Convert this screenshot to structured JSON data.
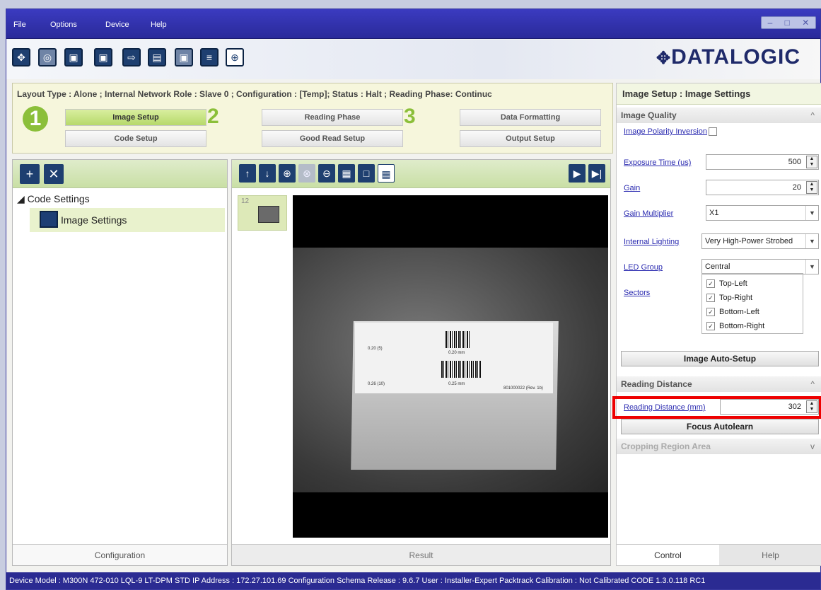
{
  "menu": {
    "file": "File",
    "options": "Options",
    "device": "Device",
    "help": "Help"
  },
  "window_controls": {
    "minimize": "–",
    "restore": "□",
    "close": "✕"
  },
  "toolbar": {
    "icons": [
      "settings-icon",
      "camera-icon",
      "device-icon",
      "device-save-icon",
      "export-icon",
      "import-icon",
      "device-load-icon",
      "network-icon",
      "target-icon"
    ]
  },
  "brand": {
    "logo": "DATALOGIC"
  },
  "wizard": {
    "layout_info": "Layout Type : Alone ; Internal Network Role : Slave 0 ; Configuration : [Temp]; Status : Halt ; Reading Phase: Continuc",
    "step1": "1",
    "step2": "2",
    "step3": "3",
    "buttons": {
      "image_setup": "Image Setup",
      "code_setup": "Code Setup",
      "reading_phase": "Reading Phase",
      "good_read_setup": "Good Read Setup",
      "data_formatting": "Data Formatting",
      "output_setup": "Output Setup"
    }
  },
  "tree": {
    "root": "Code Settings",
    "child": "Image Settings"
  },
  "left_footer": "Configuration",
  "mid": {
    "thumb_number": "12",
    "footer": "Result",
    "image_text": {
      "label1": "0.20 (5)",
      "size1": "0.20 mm",
      "label2": "0.26 (10)",
      "size2": "0.25 mm",
      "part": "801000022 (Rev. 1b)"
    }
  },
  "right": {
    "title": "Image Setup : Image Settings",
    "image_quality": {
      "header": "Image Quality",
      "polarity_label": "Image Polarity Inversion",
      "exposure_label": "Exposure Time (us)",
      "exposure_value": "500",
      "gain_label": "Gain",
      "gain_value": "20",
      "gain_multiplier_label": "Gain Multiplier",
      "gain_multiplier_value": "X1",
      "lighting_label": "Internal Lighting",
      "lighting_value": "Very High-Power Strobed",
      "led_group_label": "LED Group",
      "led_group_value": "Central",
      "sectors_label": "Sectors",
      "sectors": [
        "Top-Left",
        "Top-Right",
        "Bottom-Left",
        "Bottom-Right"
      ],
      "auto_setup_button": "Image Auto-Setup"
    },
    "reading_distance": {
      "header": "Reading Distance",
      "label": "Reading Distance (mm)",
      "value": "302",
      "autolearn_button": "Focus Autolearn"
    },
    "cropping": {
      "header": "Cropping Region Area"
    },
    "tabs": {
      "control": "Control",
      "help": "Help"
    }
  },
  "status_bar": "Device Model : M300N 472-010 LQL-9 LT-DPM STD   IP Address : 172.27.101.69   Configuration Schema Release : 9.6.7   User : Installer-Expert   Packtrack Calibration : Not Calibrated   CODE 1.3.0.118 RC1",
  "colors": {
    "menubar": "#2a2a9a",
    "accent_green": "#8bbf3a",
    "highlight_red": "#ee0000",
    "status_bar": "#2b2b92"
  }
}
